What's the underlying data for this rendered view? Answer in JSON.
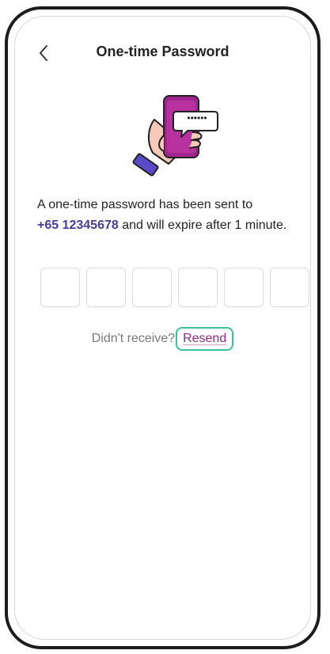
{
  "header": {
    "title": "One-time Password",
    "back_icon": "chevron-left-icon"
  },
  "illustration": {
    "icon": "phone-otp-illustration",
    "otp_dots": "••••••",
    "colors": {
      "phone": "#a0268f",
      "bubble_border": "#222222",
      "hand": "#f7c9b8",
      "sleeve": "#5a4ac8"
    }
  },
  "message": {
    "line_prefix": "A one-time password has been sent to",
    "phone_number": "+65 12345678",
    "line_suffix": "and will expire after 1 minute."
  },
  "otp": {
    "boxes": [
      "",
      "",
      "",
      "",
      "",
      ""
    ]
  },
  "resend": {
    "prompt": "Didn't receive?",
    "link_label": "Resend"
  },
  "colors": {
    "accent_text": "#4a3a9a",
    "link": "#8a2a7e",
    "focus_ring": "#3dbf9c"
  }
}
